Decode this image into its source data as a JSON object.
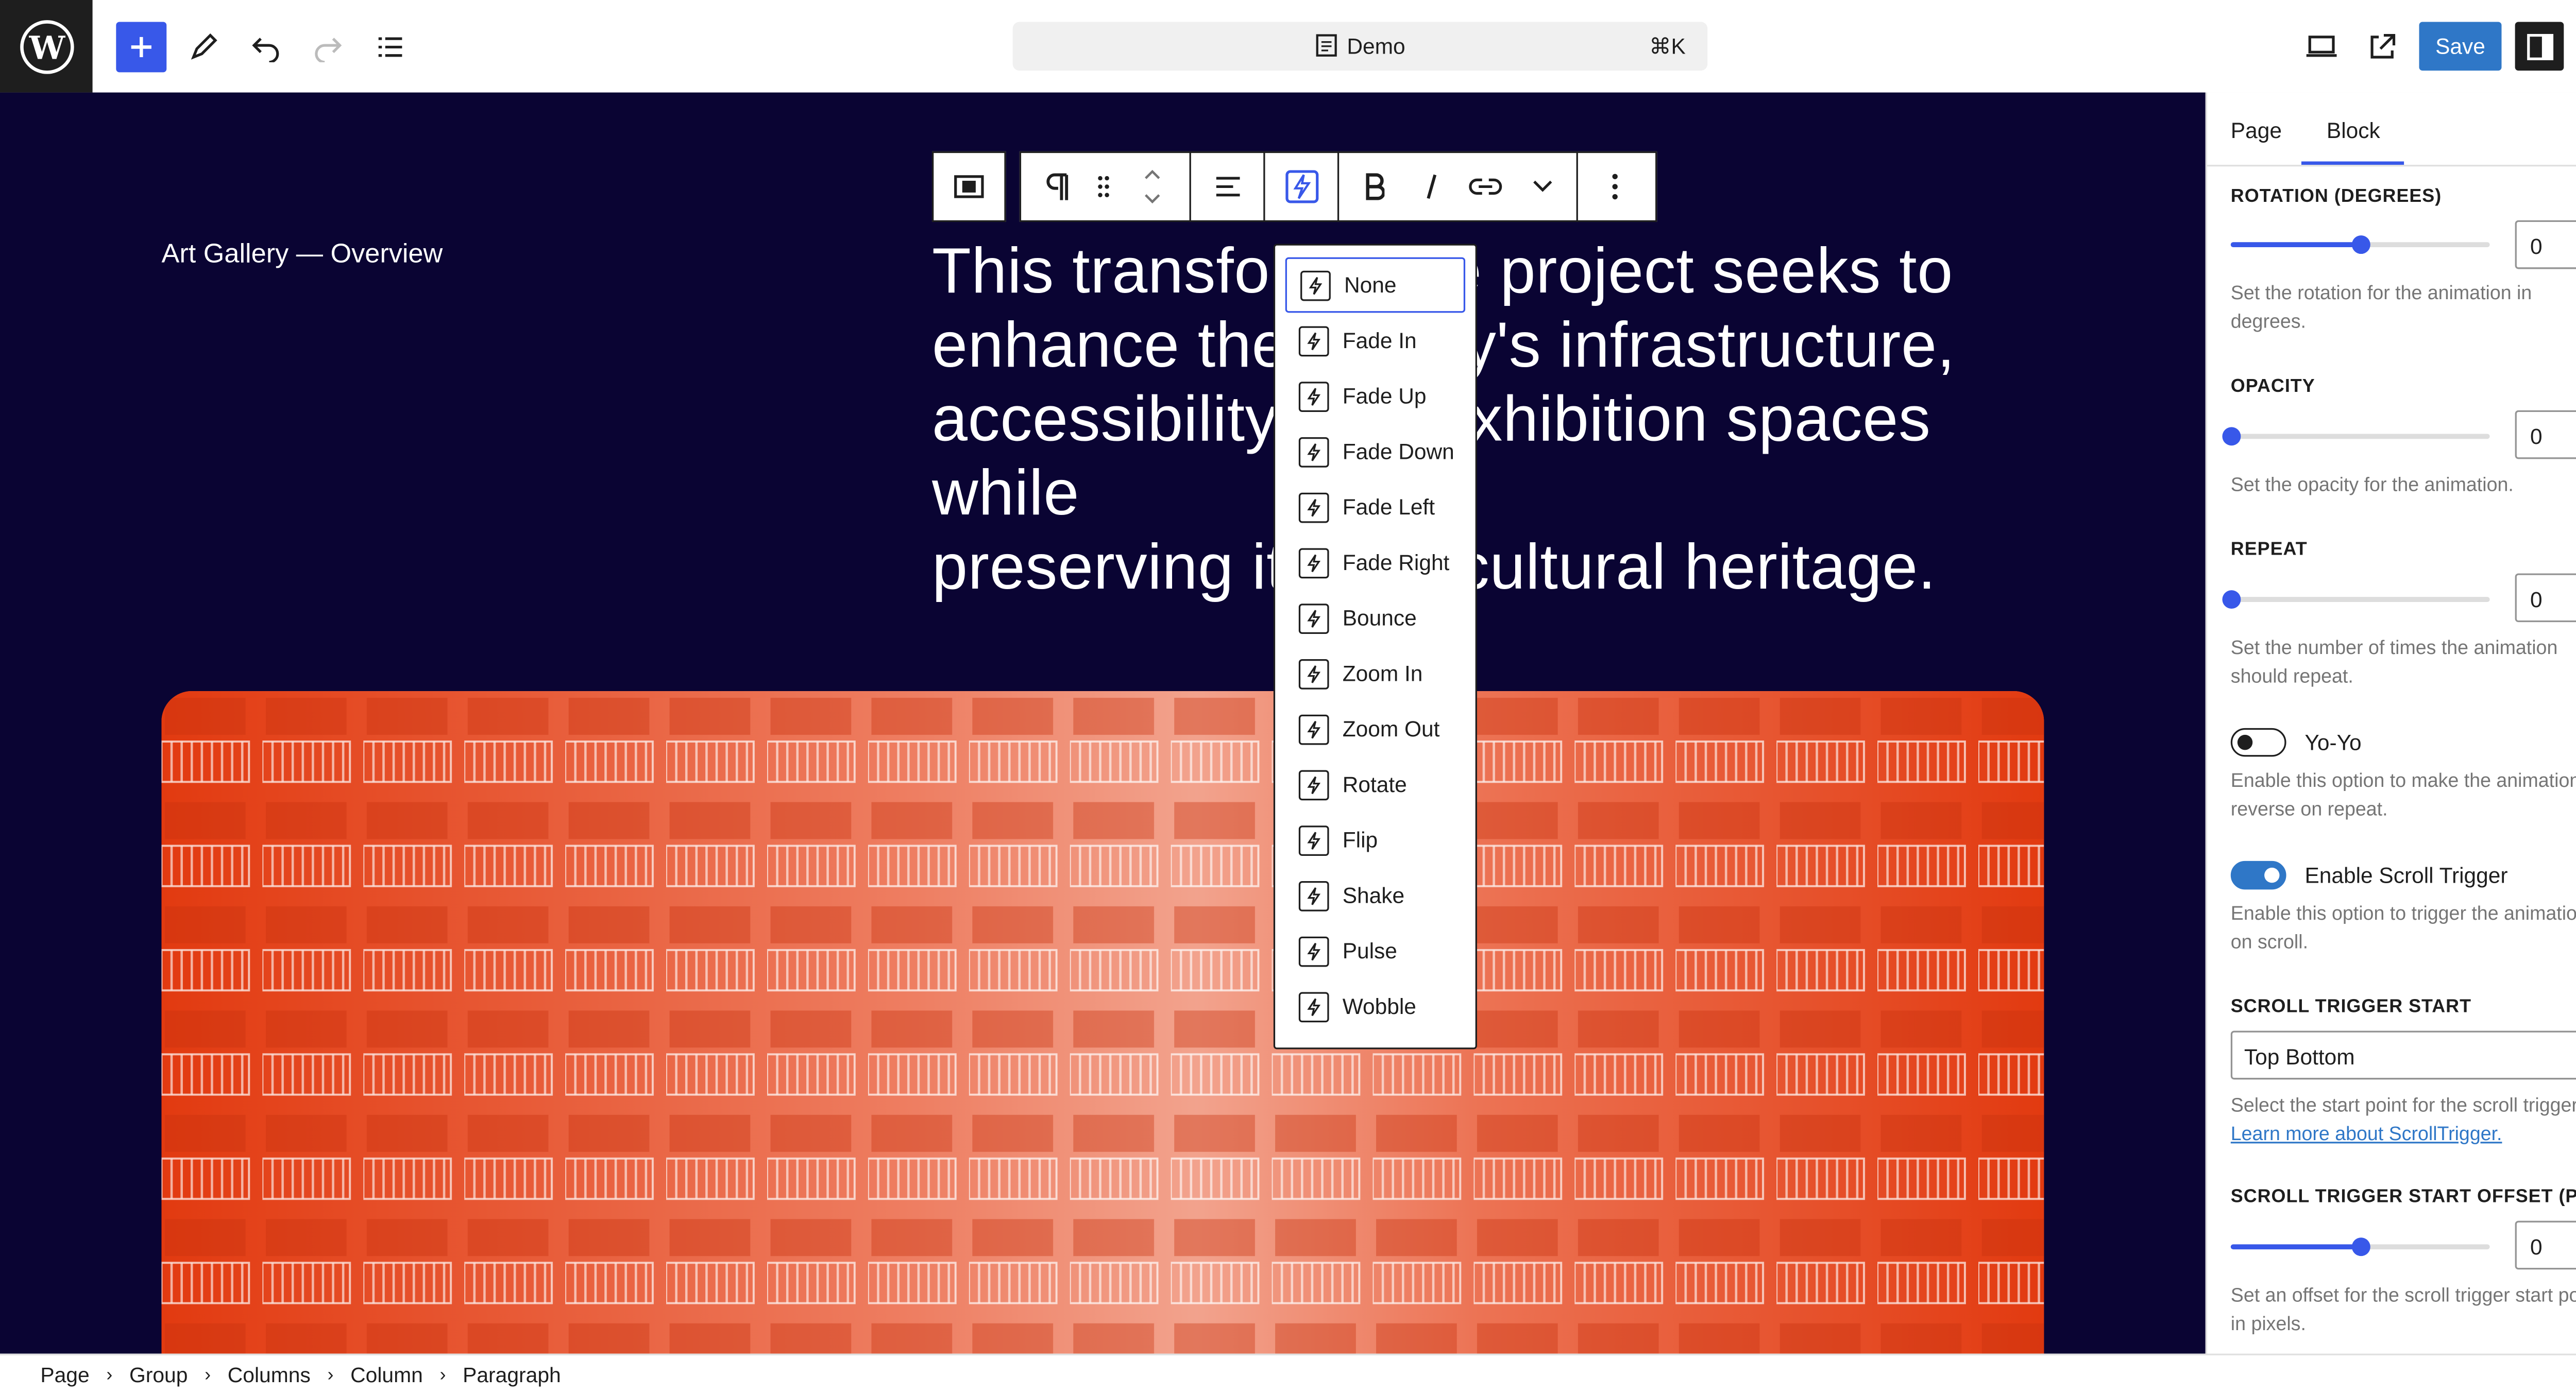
{
  "app": {
    "doc_title": "Demo",
    "shortcut": "⌘K",
    "save_label": "Save"
  },
  "canvas": {
    "site_title": "Art Gallery — Overview",
    "hero_lines": [
      "This transformative project seeks to",
      "enhance the gallery's infrastructure,",
      "accessibility, and exhibition spaces while",
      "preserving its rich cultural heritage."
    ],
    "image_color": "#e23a10"
  },
  "animation_menu": {
    "items": [
      "None",
      "Fade In",
      "Fade Up",
      "Fade Down",
      "Fade Left",
      "Fade Right",
      "Bounce",
      "Zoom In",
      "Zoom Out",
      "Rotate",
      "Flip",
      "Shake",
      "Pulse",
      "Wobble"
    ],
    "selected": "None"
  },
  "sidebar": {
    "tabs": {
      "page": "Page",
      "block": "Block"
    },
    "active_tab": "Block",
    "rotation": {
      "label": "Rotation (degrees)",
      "value": "0",
      "slider_fraction": 0.5,
      "help": "Set the rotation for the animation in degrees."
    },
    "opacity": {
      "label": "Opacity",
      "value": "0",
      "slider_fraction": 0,
      "help": "Set the opacity for the animation."
    },
    "repeat": {
      "label": "Repeat",
      "value": "0",
      "slider_fraction": 0,
      "help": "Set the number of times the animation should repeat."
    },
    "yoyo": {
      "label": "Yo-Yo",
      "on": false,
      "help": "Enable this option to make the animation reverse on repeat."
    },
    "scroll_trigger": {
      "label": "Enable Scroll Trigger",
      "on": true,
      "help": "Enable this option to trigger the animation on scroll."
    },
    "scroll_trigger_start": {
      "label": "Scroll Trigger Start",
      "value": "Top Bottom",
      "help": "Select the start point for the scroll trigger.",
      "link": "Learn more about ScrollTrigger."
    },
    "scroll_trigger_offset": {
      "label": "Scroll Trigger Start Offset (px)",
      "value": "0",
      "slider_fraction": 0.5,
      "help": "Set an offset for the scroll trigger start point in pixels."
    }
  },
  "breadcrumb": [
    "Page",
    "Group",
    "Columns",
    "Column",
    "Paragraph"
  ],
  "colors": {
    "accent": "#3858e9",
    "save": "#2f77c7",
    "canvas_bg": "#0a0433",
    "image": "#e23a10"
  }
}
